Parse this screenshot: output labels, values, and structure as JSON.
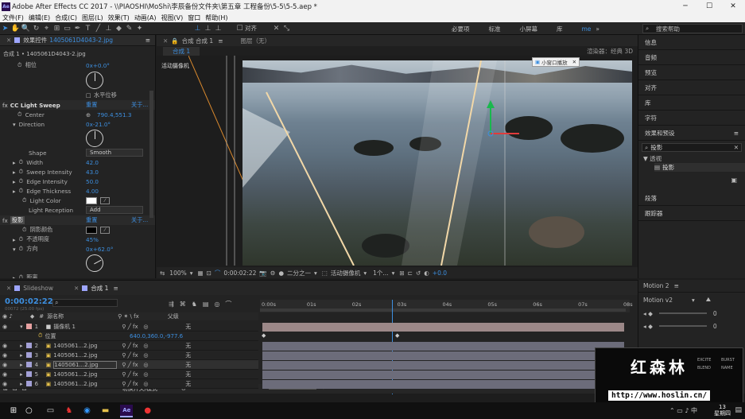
{
  "window": {
    "title": "Adobe After Effects CC 2017 - \\\\PIAOSHI\\MoShi\\李辰备份文件夹\\第五章 工程备份\\5-5\\5-5.aep *",
    "min": "─",
    "max": "☐",
    "close": "✕"
  },
  "menu": [
    "文件(F)",
    "编辑(E)",
    "合成(C)",
    "图层(L)",
    "效果(T)",
    "动画(A)",
    "视图(V)",
    "窗口",
    "帮助(H)"
  ],
  "toolbar": {
    "align_label": "对齐",
    "workspaces": [
      "必要项",
      "标准",
      "小屏幕",
      "库"
    ],
    "search_help": "搜索帮助"
  },
  "effect_controls": {
    "tab_label": "效果控件",
    "tab_file": "1405061D4043-2.jpg",
    "layer_path": "合成 1 • 1405061D4043-2.jpg",
    "phase_label": "相位",
    "phase_value": "0x+0.0°",
    "flip_label": "水平位移",
    "lightsweep": {
      "name": "CC Light Sweep",
      "reset": "重置",
      "about": "关于...",
      "center_label": "Center",
      "center_value": "790.4,551.3",
      "direction_label": "Direction",
      "direction_value": "0x-21.0°",
      "shape_label": "Shape",
      "shape_value": "Smooth",
      "width_label": "Width",
      "width_value": "42.0",
      "sweep_label": "Sweep Intensity",
      "sweep_value": "43.0",
      "edge_int_label": "Edge Intensity",
      "edge_int_value": "50.0",
      "edge_thick_label": "Edge Thickness",
      "edge_thick_value": "4.00",
      "light_color_label": "Light Color",
      "reception_label": "Light Reception",
      "reception_value": "Add"
    },
    "shadow": {
      "name": "投影",
      "reset": "重置",
      "about": "关于...",
      "color_label": "阴影颜色",
      "opacity_label": "不透明度",
      "opacity_value": "45%",
      "direction_label": "方向",
      "direction_value": "0x+62.0°",
      "distance_label": "距离"
    }
  },
  "composition": {
    "tab_label": "合成 合成 1",
    "layer_label": "图层（无）",
    "sub_tab": "合成 1",
    "active_camera": "活动摄像机",
    "renderer": "渲染器：经典 3D",
    "tooltip": "小窗口播放",
    "zoom": "100%",
    "timecode": "0:00:02:22",
    "resolution": "二分之一",
    "view_camera": "活动摄像机",
    "views": "1个...",
    "exposure": "+0.0"
  },
  "right_panels": [
    "信息",
    "音频",
    "预览",
    "对齐",
    "库",
    "字符",
    "效果和预设"
  ],
  "effects_search": "投影",
  "effects_tree": {
    "category": "▼ 透视",
    "item": "投影"
  },
  "right_panels_bottom": [
    "段落",
    "跟踪器"
  ],
  "timeline": {
    "tabs": [
      "Slideshow",
      "合成 1"
    ],
    "timecode": "0:00:02:22",
    "fps_info": "00072 (25.00 fps)",
    "header_name": "源名称",
    "header_parent": "父级",
    "ruler_ticks": [
      "0:00s",
      "01s",
      "02s",
      "03s",
      "04s",
      "05s",
      "06s",
      "07s",
      "08s"
    ],
    "layers": [
      {
        "num": "1",
        "name": "摄像机 1",
        "parent": "无"
      },
      {
        "num": "",
        "name": "位置",
        "parent": "640.0,360.0,-977.6"
      },
      {
        "num": "2",
        "name": "1405061...2.jpg",
        "parent": "无"
      },
      {
        "num": "3",
        "name": "1405061...2.jpg",
        "parent": "无"
      },
      {
        "num": "4",
        "name": "1405061...2.jpg",
        "parent": "无"
      },
      {
        "num": "5",
        "name": "1405061...2.jpg",
        "parent": "无"
      },
      {
        "num": "6",
        "name": "1405061...2.jpg",
        "parent": "无"
      }
    ],
    "footer": "切换开关/模式"
  },
  "motion": {
    "panel_title": "Motion 2",
    "version": "Motion v2",
    "values": [
      "0",
      "0"
    ]
  },
  "overlay": {
    "cn": "红森林",
    "url": "http://www.hoslin.cn/",
    "tags": [
      "EXCITE",
      "BLEND",
      "BURST",
      "NAME"
    ]
  },
  "taskbar": {
    "time": "13",
    "day": "星期四"
  },
  "colors": {
    "accent_blue": "#3d8fe0",
    "ae_purple": "#2a0b4e",
    "layer_bar": "#6c6c7a",
    "camera_bar": "#9c8888"
  }
}
